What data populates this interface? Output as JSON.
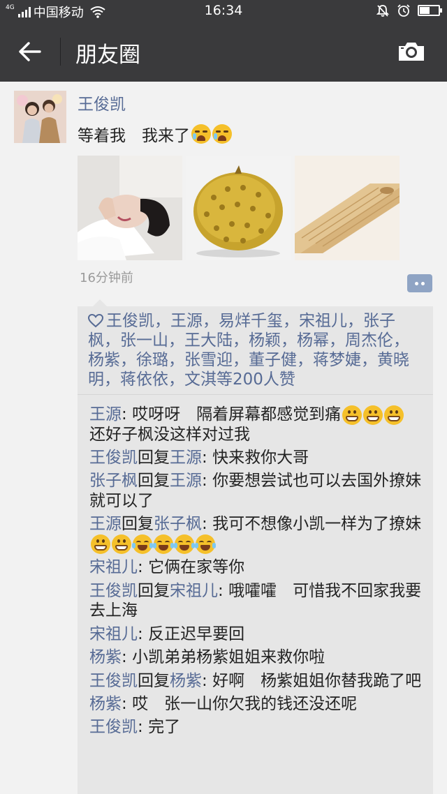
{
  "status_bar": {
    "network": "4G",
    "carrier": "中国移动",
    "time": "16:34",
    "battery_level": 0.5
  },
  "header": {
    "title": "朋友圈"
  },
  "post": {
    "author": "王俊凯",
    "text": "等着我　我来了",
    "text_emojis": [
      "cry",
      "cry"
    ],
    "image_count": 3,
    "timestamp": "16分钟前"
  },
  "likes": {
    "text": "王俊凯，王源，易烊千玺，宋祖儿，张子枫，张一山，王大陆，杨颖，杨幂，周杰伦，杨紫，徐璐，张雪迎，董子健，蒋梦婕，黄晓明，蒋依依，文淇等200人赞"
  },
  "comments": [
    {
      "from": "王源",
      "reply_to": null,
      "sep": ": ",
      "text": "哎呀呀　隔着屏幕都感觉到痛",
      "emojis": [
        "grin",
        "grin",
        "grin"
      ],
      "text2": "还好子枫没这样对过我"
    },
    {
      "from": "王俊凯",
      "reply_word": "回复",
      "reply_to": "王源",
      "sep": ": ",
      "text": "快来救你大哥"
    },
    {
      "from": "张子枫",
      "reply_word": "回复",
      "reply_to": "王源",
      "sep": ": ",
      "text": "你要想尝试也可以去国外撩妹就可以了"
    },
    {
      "from": "王源",
      "reply_word": "回复",
      "reply_to": "张子枫",
      "sep": ": ",
      "text": "我可不想像小凯一样为了撩妹",
      "emojis": [
        "grin",
        "grin",
        "laugh",
        "laugh",
        "laugh",
        "laugh"
      ]
    },
    {
      "from": "宋祖儿",
      "reply_to": null,
      "sep": ": ",
      "text": "它俩在家等你"
    },
    {
      "from": "王俊凯",
      "reply_word": "回复",
      "reply_to": "宋祖儿",
      "sep": ": ",
      "text": "哦嚯嚯　可惜我不回家我要去上海"
    },
    {
      "from": "宋祖儿",
      "reply_to": null,
      "sep": ": ",
      "text": "反正迟早要回"
    },
    {
      "from": "杨紫",
      "reply_to": null,
      "sep": ": ",
      "text": "小凯弟弟杨紫姐姐来救你啦"
    },
    {
      "from": "王俊凯",
      "reply_word": "回复",
      "reply_to": "杨紫",
      "sep": ": ",
      "text": "好啊　杨紫姐姐你替我跪了吧"
    },
    {
      "from": "杨紫",
      "reply_to": null,
      "sep": ": ",
      "text": "哎　张一山你欠我的钱还没还呢"
    },
    {
      "from": "王俊凯",
      "reply_to": null,
      "sep": ": ",
      "text": "完了"
    }
  ]
}
